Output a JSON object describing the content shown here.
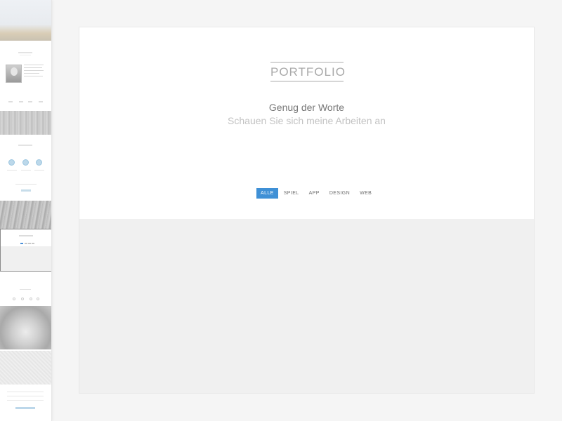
{
  "portfolio": {
    "title": "PORTFOLIO",
    "headline": "Genug der Worte",
    "subheadline": "Schauen Sie sich meine Arbeiten an",
    "filters": [
      {
        "label": "ALLE",
        "active": true
      },
      {
        "label": "SPIEL",
        "active": false
      },
      {
        "label": "APP",
        "active": false
      },
      {
        "label": "DESIGN",
        "active": false
      },
      {
        "label": "WEB",
        "active": false
      }
    ]
  },
  "colors": {
    "accent": "#3f90d6",
    "page_background": "#f5f5f5",
    "gallery_background": "#f0f0f0"
  }
}
